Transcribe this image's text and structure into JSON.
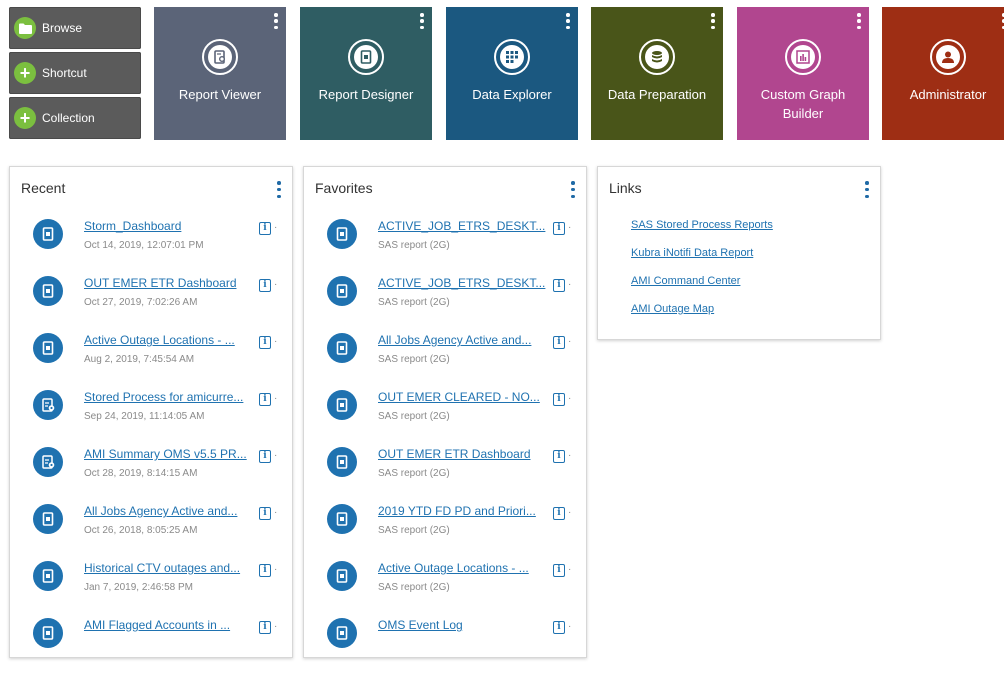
{
  "actions": [
    {
      "label": "Browse",
      "icon": "folder-icon"
    },
    {
      "label": "Shortcut",
      "icon": "plus-icon"
    },
    {
      "label": "Collection",
      "icon": "plus-icon"
    }
  ],
  "tiles": [
    {
      "label": "Report Viewer",
      "color": "#5b6478",
      "icon": "report-viewer-icon"
    },
    {
      "label": "Report Designer",
      "color": "#2f5d63",
      "icon": "report-designer-icon"
    },
    {
      "label": "Data Explorer",
      "color": "#1b5880",
      "icon": "data-explorer-icon"
    },
    {
      "label": "Data Preparation",
      "color": "#495519",
      "icon": "data-preparation-icon"
    },
    {
      "label": "Custom Graph Builder",
      "color": "#b1468f",
      "icon": "graph-builder-icon"
    },
    {
      "label": "Administrator",
      "color": "#9e2e14",
      "icon": "administrator-icon"
    }
  ],
  "recent": {
    "title": "Recent",
    "items": [
      {
        "name": "Storm_Dashboard",
        "sub": "Oct 14, 2019, 12:07:01 PM",
        "icon": "report-icon"
      },
      {
        "name": "OUT EMER ETR Dashboard",
        "sub": "Oct 27, 2019, 7:02:26 AM",
        "icon": "report-icon"
      },
      {
        "name": "Active Outage Locations - ...",
        "sub": "Aug 2, 2019, 7:45:54 AM",
        "icon": "report-icon"
      },
      {
        "name": "Stored Process for amicurre...",
        "sub": "Sep 24, 2019, 11:14:05 AM",
        "icon": "stored-process-icon"
      },
      {
        "name": "AMI Summary OMS v5.5 PR...",
        "sub": "Oct 28, 2019, 8:14:15 AM",
        "icon": "stored-process-icon"
      },
      {
        "name": "All Jobs Agency Active and...",
        "sub": "Oct 26, 2018, 8:05:25 AM",
        "icon": "report-icon"
      },
      {
        "name": "Historical CTV outages and...",
        "sub": "Jan 7, 2019, 2:46:58 PM",
        "icon": "report-icon"
      },
      {
        "name": "AMI Flagged Accounts in ...",
        "sub": "",
        "icon": "report-icon"
      }
    ]
  },
  "favorites": {
    "title": "Favorites",
    "items": [
      {
        "name": "ACTIVE_JOB_ETRS_DESKT...",
        "sub": "SAS report (2G)",
        "icon": "report-icon"
      },
      {
        "name": "ACTIVE_JOB_ETRS_DESKT...",
        "sub": "SAS report (2G)",
        "icon": "report-icon"
      },
      {
        "name": "All Jobs Agency Active and...",
        "sub": "SAS report (2G)",
        "icon": "report-icon"
      },
      {
        "name": "OUT EMER CLEARED - NO...",
        "sub": "SAS report (2G)",
        "icon": "report-icon"
      },
      {
        "name": "OUT EMER ETR Dashboard",
        "sub": "SAS report (2G)",
        "icon": "report-icon"
      },
      {
        "name": "2019 YTD FD PD and Priori...",
        "sub": "SAS report (2G)",
        "icon": "report-icon"
      },
      {
        "name": "Active Outage Locations - ...",
        "sub": "SAS report (2G)",
        "icon": "report-icon"
      },
      {
        "name": "OMS Event Log",
        "sub": "",
        "icon": "report-icon"
      }
    ]
  },
  "links": {
    "title": "Links",
    "items": [
      "SAS Stored Process Reports",
      "Kubra iNotifi Data Report",
      "AMI Command Center",
      "AMI Outage Map"
    ]
  },
  "info_glyph": "i",
  "dash_glyph": "·"
}
